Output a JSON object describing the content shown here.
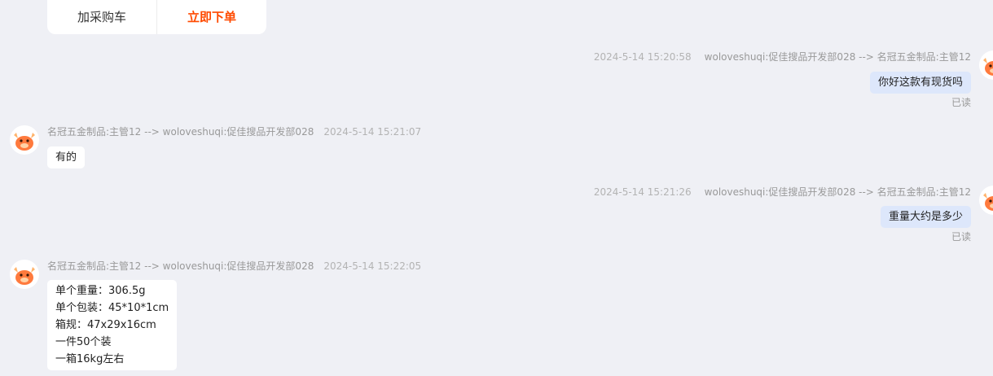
{
  "top_card": {
    "add_to_cart": "加采购车",
    "buy_now": "立即下单"
  },
  "messages": [
    {
      "direction": "out",
      "time": "2024-5-14 15:20:58",
      "route": "woloveshuqi:促佳搜品开发部028 --> 名冠五金制品:主管12",
      "text": "你好这款有现货吗",
      "status": "已读"
    },
    {
      "direction": "in",
      "route": "名冠五金制品:主管12 --> woloveshuqi:促佳搜品开发部028",
      "time": "2024-5-14 15:21:07",
      "text": "有的"
    },
    {
      "direction": "out",
      "time": "2024-5-14 15:21:26",
      "route": "woloveshuqi:促佳搜品开发部028 --> 名冠五金制品:主管12",
      "text": "重量大约是多少",
      "status": "已读"
    },
    {
      "direction": "in",
      "route": "名冠五金制品:主管12 --> woloveshuqi:促佳搜品开发部028",
      "time": "2024-5-14 15:22:05",
      "lines": [
        "单个重量：306.5g",
        "单个包装：45*10*1cm",
        "箱规：47x29x16cm",
        "一件50个装",
        "一箱16kg左右"
      ]
    }
  ],
  "colors": {
    "background": "#eff0f5",
    "outgoing_bubble": "#dde7fb",
    "incoming_bubble": "#ffffff",
    "buy_now": "#ff4a00",
    "avatar_accent": "#ff7a3d"
  }
}
